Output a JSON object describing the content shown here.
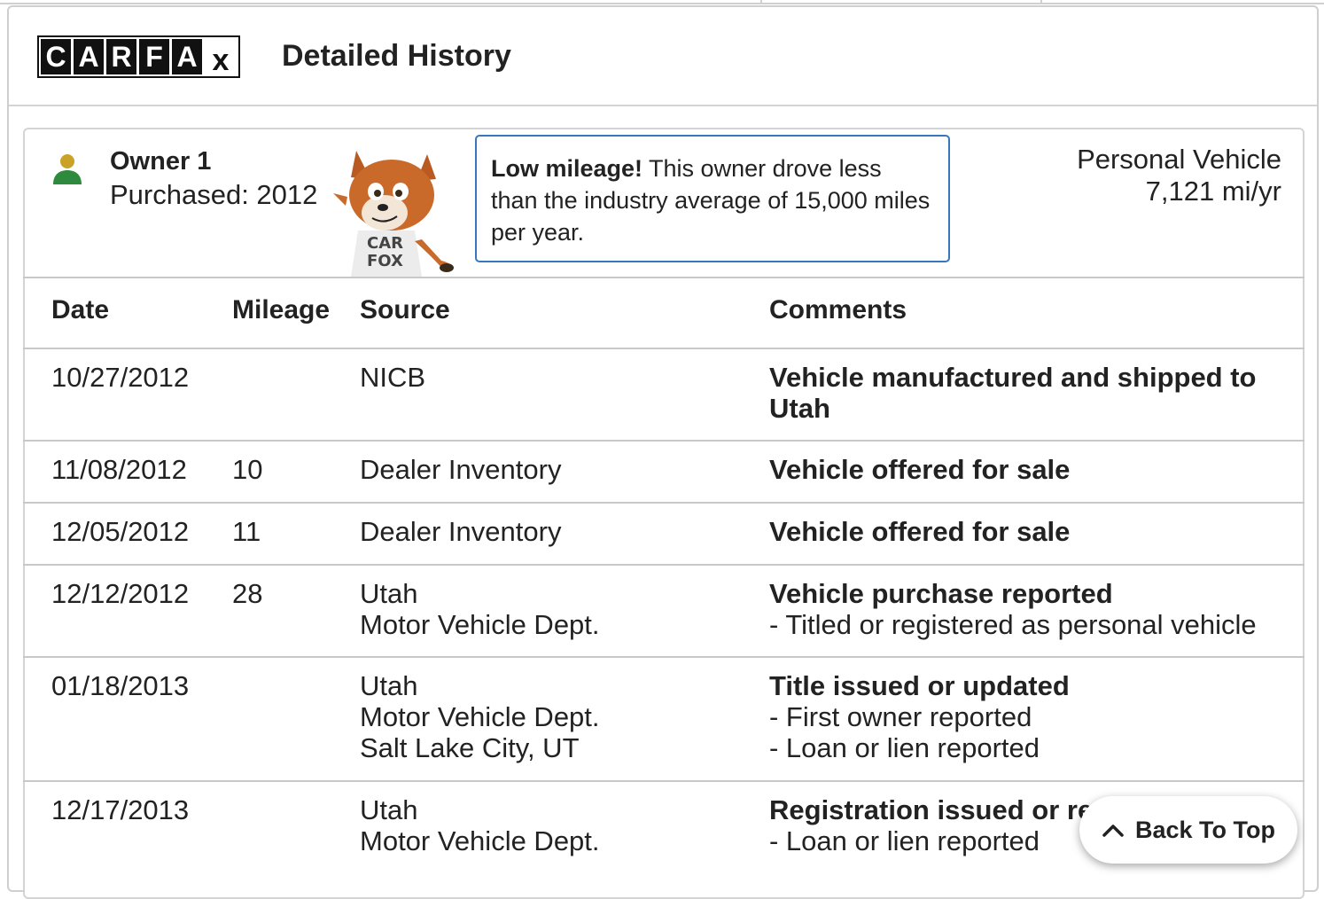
{
  "header": {
    "logo_letters": [
      "C",
      "A",
      "R",
      "F",
      "A",
      "x"
    ],
    "title": "Detailed History"
  },
  "owner": {
    "name": "Owner 1",
    "purchased": "Purchased: 2012",
    "person_icon_color": "#2e8b3d",
    "person_head_color": "#c9a227",
    "callout": {
      "bold": "Low mileage!",
      "text": " This owner drove less than the industry average of 15,000 miles per year."
    },
    "vehicle_type": "Personal Vehicle",
    "miles_per_year": "7,121 mi/yr",
    "mascot_shirt_text": [
      "CAR",
      "FOX"
    ]
  },
  "table": {
    "columns": [
      "Date",
      "Mileage",
      "Source",
      "Comments"
    ],
    "rows": [
      {
        "date": "10/27/2012",
        "mileage": "",
        "source": [
          "NICB"
        ],
        "comment_title": "Vehicle manufactured and shipped to Utah",
        "comment_lines": []
      },
      {
        "date": "11/08/2012",
        "mileage": "10",
        "source": [
          "Dealer Inventory"
        ],
        "comment_title": "Vehicle offered for sale",
        "comment_lines": []
      },
      {
        "date": "12/05/2012",
        "mileage": "11",
        "source": [
          "Dealer Inventory"
        ],
        "comment_title": "Vehicle offered for sale",
        "comment_lines": []
      },
      {
        "date": "12/12/2012",
        "mileage": "28",
        "source": [
          "Utah",
          "Motor Vehicle Dept."
        ],
        "comment_title": "Vehicle purchase reported",
        "comment_lines": [
          "- Titled or registered as personal vehicle"
        ]
      },
      {
        "date": "01/18/2013",
        "mileage": "",
        "source": [
          "Utah",
          "Motor Vehicle Dept.",
          "Salt Lake City, UT"
        ],
        "comment_title": "Title issued or updated",
        "comment_lines": [
          "- First owner reported",
          "- Loan or lien reported"
        ]
      },
      {
        "date": "12/17/2013",
        "mileage": "",
        "source": [
          "Utah",
          "Motor Vehicle Dept."
        ],
        "comment_title": "Registration issued or re",
        "comment_lines": [
          "- Loan or lien reported"
        ]
      }
    ]
  },
  "back_to_top": {
    "label": "Back To Top"
  },
  "colors": {
    "callout_border": "#3777bc",
    "border": "#c8c8c8"
  }
}
